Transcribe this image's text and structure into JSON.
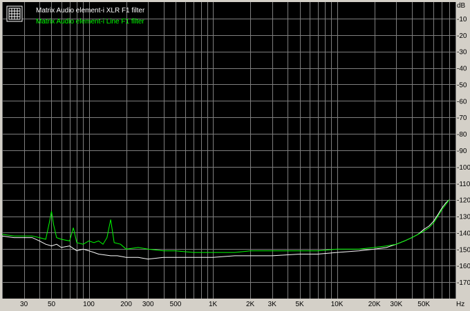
{
  "chart_data": {
    "type": "line",
    "title": "",
    "xlabel": "",
    "ylabel": "",
    "x_scale": "log",
    "xlim": [
      20,
      90000
    ],
    "ylim": [
      -180,
      0
    ],
    "x_unit": "Hz",
    "y_unit": "dB",
    "grid": true,
    "legend": "top-left",
    "background_color": "#000000",
    "frame_color": "#d4d0c8",
    "grid_color": "#7f7f7f",
    "legend_icon": "grid-icon",
    "x_ticks": [
      {
        "value": 30,
        "label": "30"
      },
      {
        "value": 50,
        "label": "50"
      },
      {
        "value": 100,
        "label": "100"
      },
      {
        "value": 200,
        "label": "200"
      },
      {
        "value": 300,
        "label": "300"
      },
      {
        "value": 500,
        "label": "500"
      },
      {
        "value": 1000,
        "label": "1K"
      },
      {
        "value": 2000,
        "label": "2K"
      },
      {
        "value": 3000,
        "label": "3K"
      },
      {
        "value": 5000,
        "label": "5K"
      },
      {
        "value": 10000,
        "label": "10K"
      },
      {
        "value": 20000,
        "label": "20K"
      },
      {
        "value": 30000,
        "label": "30K"
      },
      {
        "value": 50000,
        "label": "50K"
      }
    ],
    "y_ticks": [
      {
        "value": -10,
        "label": "-10"
      },
      {
        "value": -20,
        "label": "-20"
      },
      {
        "value": -30,
        "label": "-30"
      },
      {
        "value": -40,
        "label": "-40"
      },
      {
        "value": -50,
        "label": "-50"
      },
      {
        "value": -60,
        "label": "-60"
      },
      {
        "value": -70,
        "label": "-70"
      },
      {
        "value": -80,
        "label": "-80"
      },
      {
        "value": -90,
        "label": "-90"
      },
      {
        "value": -100,
        "label": "-100"
      },
      {
        "value": -110,
        "label": "-110"
      },
      {
        "value": -120,
        "label": "-120"
      },
      {
        "value": -130,
        "label": "-130"
      },
      {
        "value": -140,
        "label": "-140"
      },
      {
        "value": -150,
        "label": "-150"
      },
      {
        "value": -160,
        "label": "-160"
      },
      {
        "value": -170,
        "label": "-170"
      }
    ],
    "series": [
      {
        "name": "Matrix Audio element-i XLR F1 filter",
        "color": "#ffffff",
        "x": [
          20,
          25,
          30,
          35,
          40,
          45,
          50,
          55,
          60,
          70,
          80,
          90,
          100,
          110,
          120,
          150,
          170,
          200,
          250,
          300,
          400,
          500,
          700,
          1000,
          1500,
          2000,
          3000,
          5000,
          7000,
          10000,
          15000,
          20000,
          25000,
          30000,
          35000,
          40000,
          45000,
          50000,
          55000,
          60000,
          65000,
          70000,
          75000,
          80000
        ],
        "y": [
          -142,
          -143,
          -143,
          -143,
          -145,
          -147,
          -148,
          -147,
          -149,
          -148,
          -151,
          -150,
          -151,
          -152,
          -153,
          -154,
          -154,
          -155,
          -155,
          -156,
          -155,
          -155,
          -155,
          -155,
          -154,
          -154,
          -154,
          -153,
          -153,
          -152,
          -151,
          -150,
          -149,
          -147,
          -145,
          -143,
          -141,
          -138,
          -136,
          -133,
          -129,
          -125,
          -122,
          -120
        ]
      },
      {
        "name": "Matrix Audio element-i Line F1 filter",
        "color": "#00ff00",
        "x": [
          20,
          25,
          30,
          35,
          40,
          45,
          48,
          50,
          52,
          55,
          60,
          70,
          75,
          80,
          90,
          100,
          110,
          120,
          130,
          140,
          150,
          160,
          180,
          200,
          250,
          300,
          400,
          500,
          700,
          1000,
          1500,
          2000,
          3000,
          5000,
          7000,
          10000,
          15000,
          20000,
          25000,
          30000,
          35000,
          40000,
          45000,
          50000,
          55000,
          60000,
          65000,
          70000,
          75000,
          80000
        ],
        "y": [
          -141,
          -142,
          -142,
          -142,
          -143,
          -144,
          -134,
          -127,
          -135,
          -143,
          -144,
          -145,
          -137,
          -146,
          -147,
          -145,
          -146,
          -145,
          -147,
          -143,
          -132,
          -146,
          -147,
          -150,
          -149,
          -150,
          -151,
          -151,
          -152,
          -152,
          -152,
          -151,
          -151,
          -151,
          -151,
          -150,
          -150,
          -149,
          -148,
          -147,
          -145,
          -143,
          -141,
          -139,
          -137,
          -134,
          -130,
          -126,
          -123,
          -120
        ]
      }
    ]
  }
}
